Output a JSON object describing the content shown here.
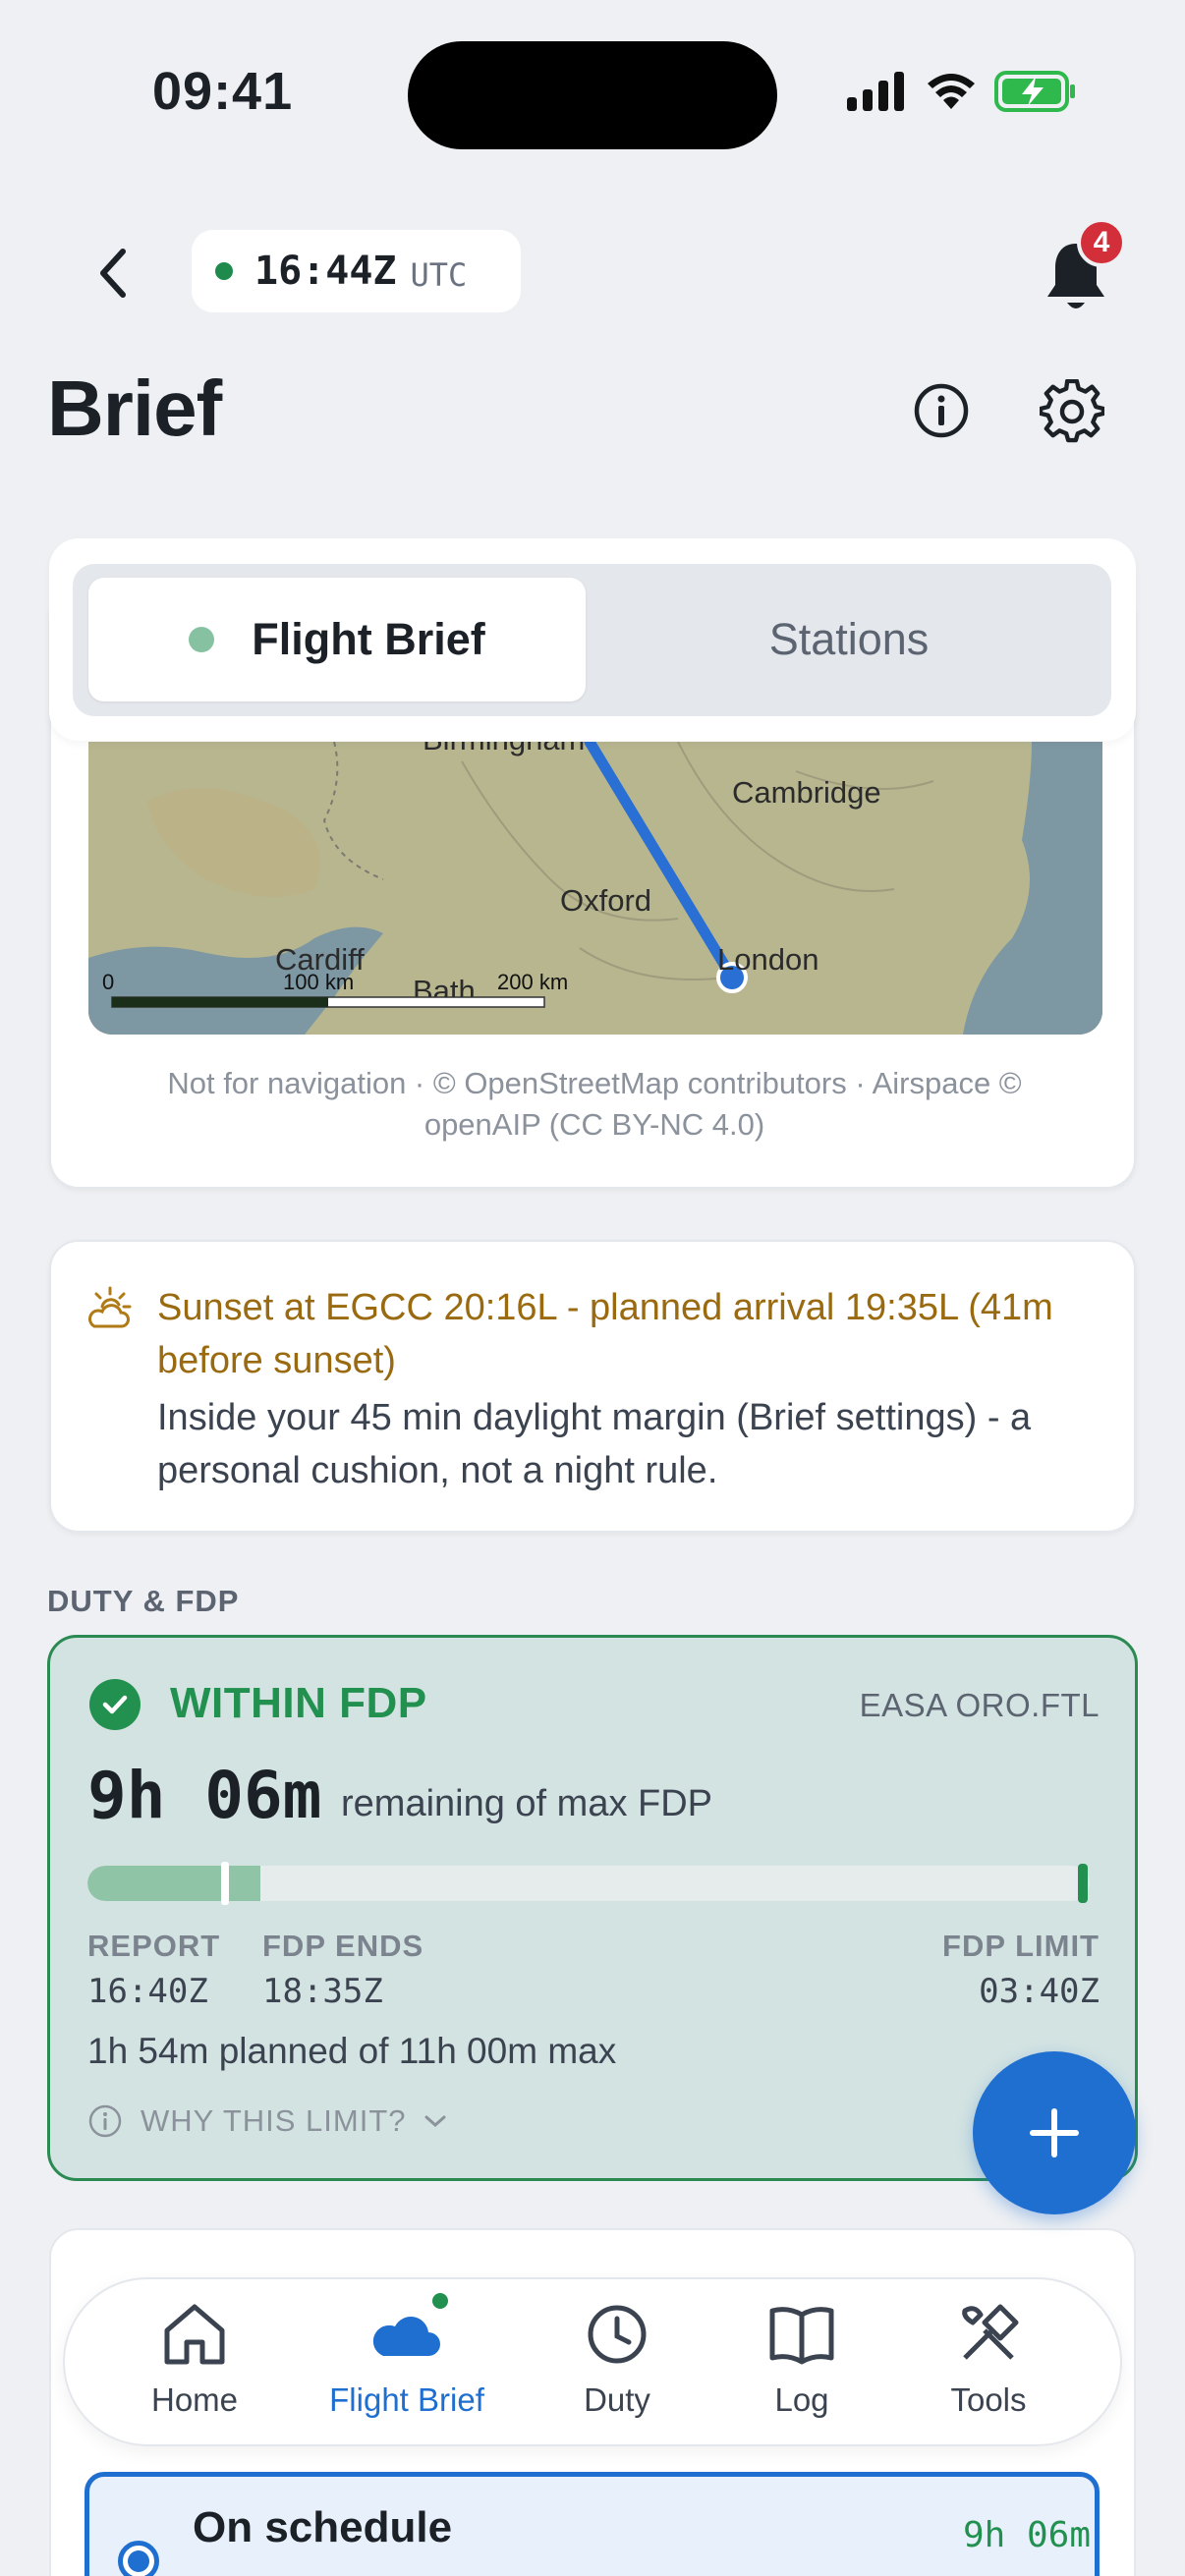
{
  "status_bar": {
    "time": "09:41"
  },
  "header": {
    "utc_time": "16:44Z",
    "utc_label": "UTC",
    "notification_count": "4",
    "title": "Brief"
  },
  "segmented": {
    "items": [
      {
        "label": "Flight Brief",
        "active": true
      },
      {
        "label": "Stations",
        "active": false
      }
    ]
  },
  "map": {
    "labels": {
      "birmingham": "Birmingham",
      "cambridge": "Cambridge",
      "oxford": "Oxford",
      "cardiff": "Cardiff",
      "bath": "Bath",
      "london": "London"
    },
    "scale": {
      "zero": "0",
      "mid": "100 km",
      "max": "200 km"
    },
    "attribution": "Not for navigation · © OpenStreetMap contributors · Airspace © openAIP (CC BY-NC 4.0)"
  },
  "sunset": {
    "title": "Sunset at EGCC 20:16L - planned arrival 19:35L (41m before sunset)",
    "body": "Inside your 45 min daylight margin (Brief settings) - a personal cushion, not a night rule.",
    "accent": "#9a6a10"
  },
  "duty": {
    "section_label": "DUTY & FDP",
    "status": "WITHIN FDP",
    "regulation": "EASA ORO.FTL",
    "remaining": "9h 06m",
    "remaining_sub": "remaining of max FDP",
    "progress_fraction": 0.173,
    "report_label": "REPORT",
    "report_value": "16:40Z",
    "fdp_ends_label": "FDP ENDS",
    "fdp_ends_value": "18:35Z",
    "fdp_limit_label": "FDP LIMIT",
    "fdp_limit_value": "03:40Z",
    "planned": "1h 54m planned of 11h 00m max",
    "why": "WHY THIS LIMIT?",
    "status_color": "#22904f"
  },
  "next_card": {
    "schedule_title": "On schedule",
    "schedule_time": "9h 06m"
  },
  "tabbar": {
    "items": [
      {
        "label": "Home",
        "icon": "home-icon"
      },
      {
        "label": "Flight Brief",
        "icon": "cloud-icon",
        "active": true
      },
      {
        "label": "Duty",
        "icon": "clock-icon"
      },
      {
        "label": "Log",
        "icon": "book-icon"
      },
      {
        "label": "Tools",
        "icon": "tools-icon"
      }
    ]
  },
  "colors": {
    "accent": "#1f6fd0",
    "green": "#22904f",
    "badge": "#d32f3a"
  }
}
